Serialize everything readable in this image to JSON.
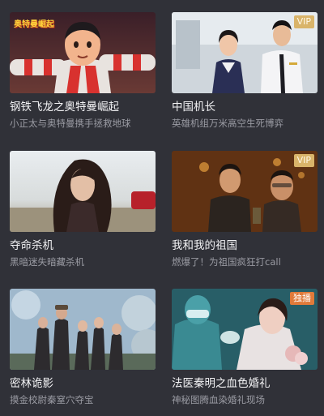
{
  "movies": [
    {
      "title": "钢铁飞龙之奥特曼崛起",
      "subtitle": "小正太与奥特曼携手拯救地球",
      "badge": "",
      "poster_logo": "奥特曼崛起"
    },
    {
      "title": "中国机长",
      "subtitle": "英雄机组万米高空生死博弈",
      "badge": "VIP"
    },
    {
      "title": "夺命杀机",
      "subtitle": "黑暗迷失暗藏杀机",
      "badge": ""
    },
    {
      "title": "我和我的祖国",
      "subtitle": "燃爆了！为祖国疯狂打call",
      "badge": "VIP"
    },
    {
      "title": "密林诡影",
      "subtitle": "摸金校尉秦窒穴夺宝",
      "badge": ""
    },
    {
      "title": "法医秦明之血色婚礼",
      "subtitle": "神秘图腾血染婚礼现场",
      "badge": "独播"
    }
  ],
  "colors": {
    "background": "#303138",
    "title": "#f2f2f4",
    "subtitle": "#9a9ba3",
    "vip_badge": "#d9b46a",
    "exclusive_badge": "#e07a3a"
  }
}
